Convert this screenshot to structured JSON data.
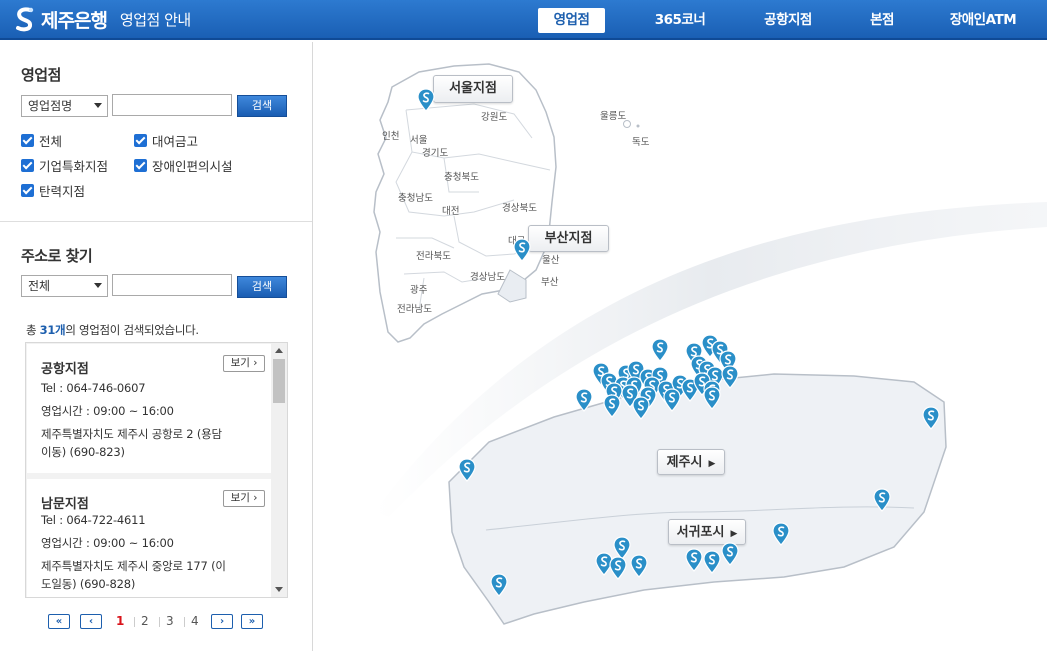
{
  "header": {
    "brand": "제주은행",
    "subtitle": "영업점 안내",
    "nav": [
      {
        "label": "영업점",
        "active": true
      },
      {
        "label": "365코너",
        "active": false
      },
      {
        "label": "공항지점",
        "active": false
      },
      {
        "label": "본점",
        "active": false
      },
      {
        "label": "장애인ATM",
        "active": false
      }
    ]
  },
  "branch_search": {
    "title": "영업점",
    "select_value": "영업점명",
    "search_label": "검색",
    "filters": [
      {
        "label": "전체",
        "checked": true
      },
      {
        "label": "대여금고",
        "checked": true
      },
      {
        "label": "기업특화지점",
        "checked": true
      },
      {
        "label": "장애인편의시설",
        "checked": true
      },
      {
        "label": "탄력지점",
        "checked": true
      }
    ]
  },
  "address_search": {
    "title": "주소로 찾기",
    "select_value": "전체",
    "search_label": "검색"
  },
  "results": {
    "prefix": "총 ",
    "count": "31개",
    "suffix": "의 영업점이 검색되었습니다.",
    "items": [
      {
        "name": "공항지점",
        "view_label": "보기",
        "tel": "Tel : 064-746-0607",
        "hours": "영업시간 : 09:00 ~ 16:00",
        "address_1": "제주특별자치도 제주시 공항로 2 (용담",
        "address_2": "이동) (690-823)"
      },
      {
        "name": "남문지점",
        "view_label": "보기",
        "tel": "Tel : 064-722-4611",
        "hours": "영업시간 : 09:00 ~ 16:00",
        "address_1": "제주특별자치도 제주시 중앙로 177 (이",
        "address_2": "도일동) (690-828)"
      }
    ]
  },
  "pagination": {
    "first": "«",
    "prev": "‹",
    "next": "›",
    "last": "»",
    "pages": [
      "1",
      "2",
      "3",
      "4"
    ],
    "current": "1"
  },
  "map": {
    "korea_labels": {
      "seoul_branch": "서울지점",
      "busan_branch": "부산지점"
    },
    "regions": {
      "incheon": "인천",
      "seoul": "서울",
      "gyeonggi": "경기도",
      "gangwon": "강원도",
      "ulleungdo": "울릉도",
      "dokdo": "독도",
      "chungbuk": "충청북도",
      "chungnam": "충청남도",
      "daejeon": "대전",
      "gyeongbuk": "경상북도",
      "daegu": "대구",
      "ulsan": "울산",
      "busan": "부산",
      "jeonbuk": "전라북도",
      "gyeongnam": "경상남도",
      "gwangju": "광주",
      "jeonnam": "전라남도"
    },
    "jeju_labels": {
      "jeju_city": "제주시",
      "seogwipo_city": "서귀포시"
    },
    "pin_color": "#2a8fc8"
  }
}
